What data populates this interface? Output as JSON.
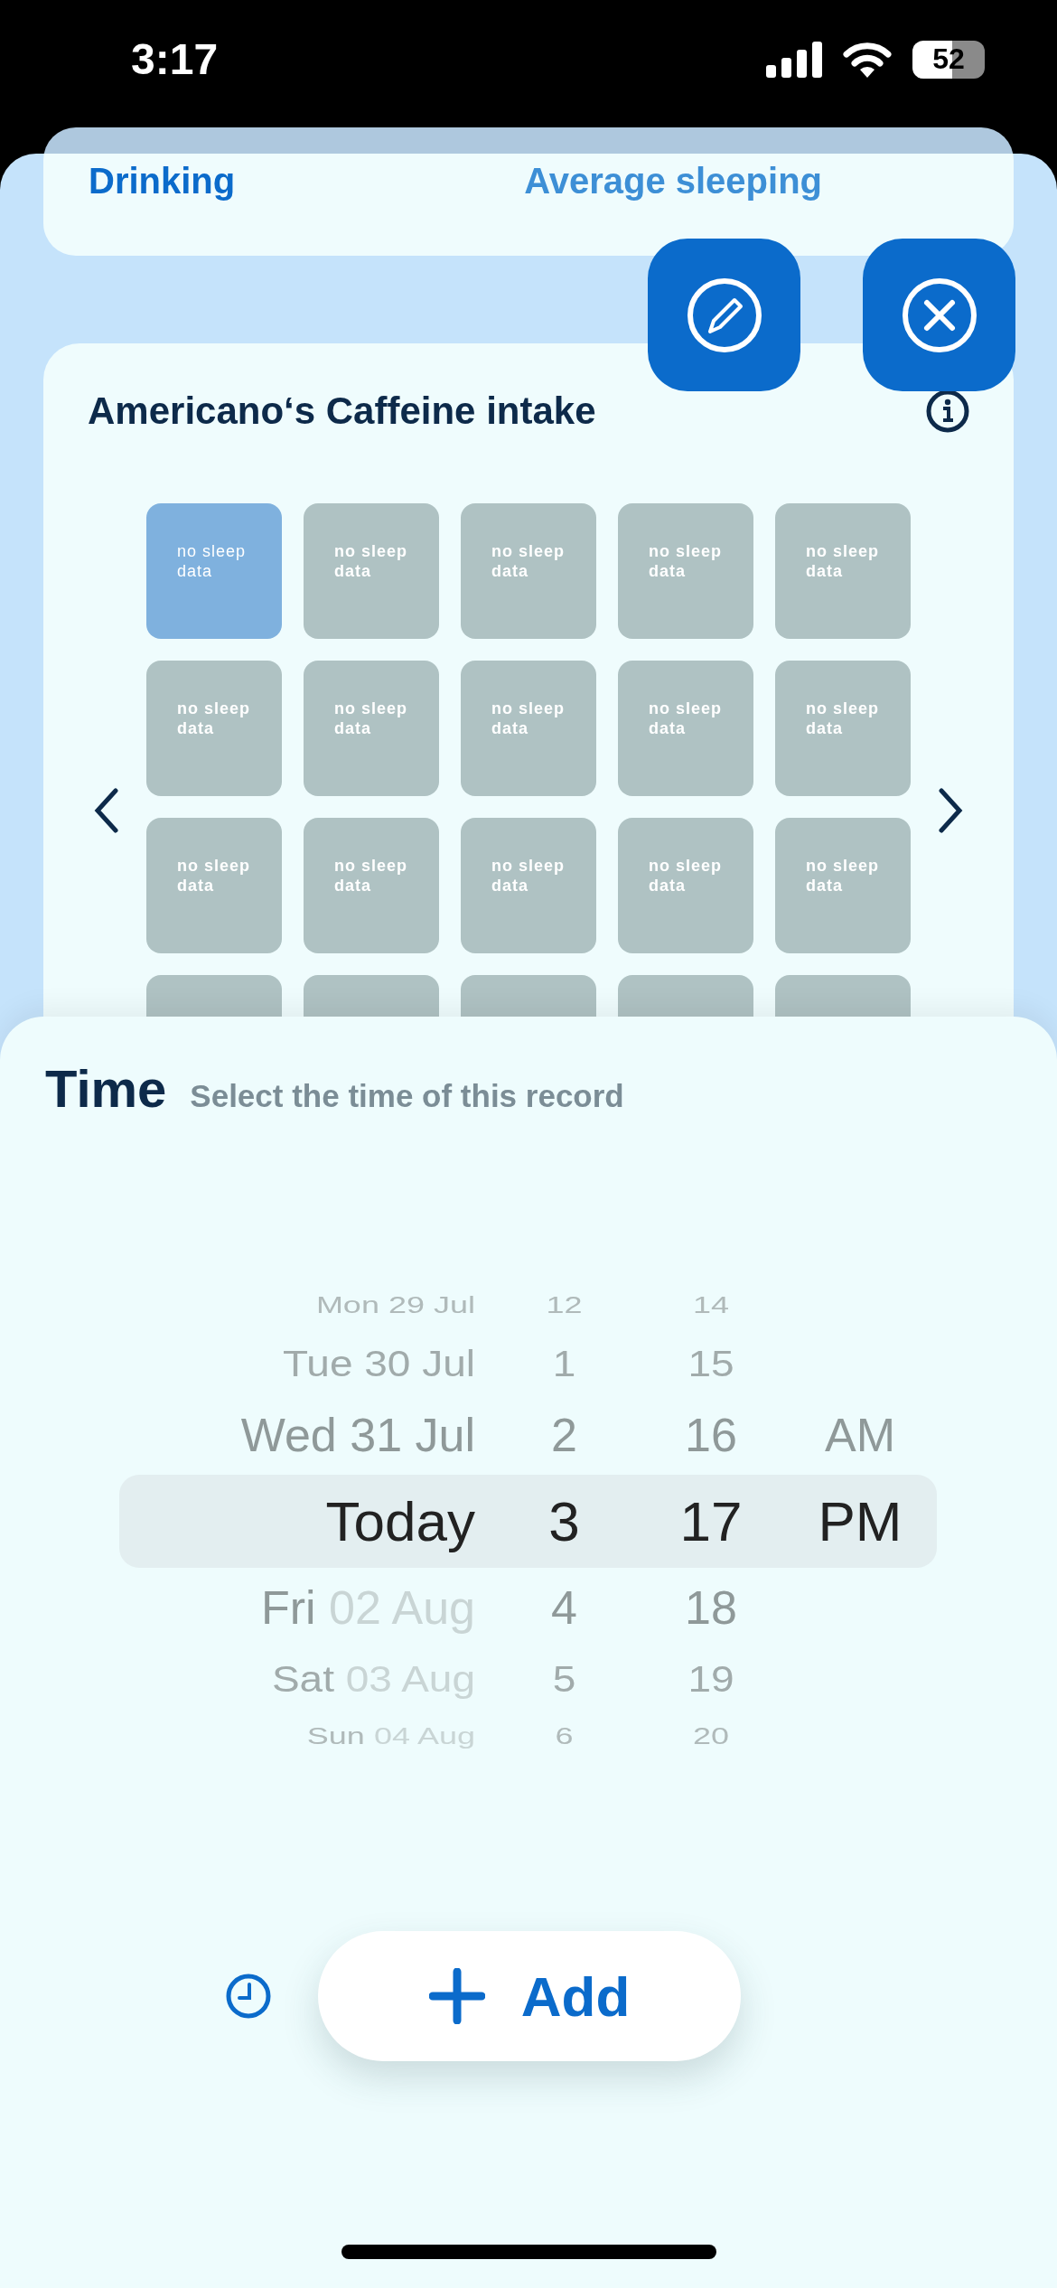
{
  "status_bar": {
    "time": "3:17",
    "battery": "52"
  },
  "summary_card": {
    "tabs": [
      {
        "label": "Drinking",
        "selected": true
      },
      {
        "label": "Average sleeping",
        "selected": false
      }
    ]
  },
  "intake_card": {
    "title": "Americano‘s Caffeine intake",
    "cells": [
      {
        "label": "no sleep data",
        "selected": true
      },
      {
        "label": "no sleep data",
        "selected": false
      },
      {
        "label": "no sleep data",
        "selected": false
      },
      {
        "label": "no sleep data",
        "selected": false
      },
      {
        "label": "no sleep data",
        "selected": false
      },
      {
        "label": "no sleep data",
        "selected": false
      },
      {
        "label": "no sleep data",
        "selected": false
      },
      {
        "label": "no sleep data",
        "selected": false
      },
      {
        "label": "no sleep data",
        "selected": false
      },
      {
        "label": "no sleep data",
        "selected": false
      },
      {
        "label": "no sleep data",
        "selected": false
      },
      {
        "label": "no sleep data",
        "selected": false
      },
      {
        "label": "no sleep data",
        "selected": false
      },
      {
        "label": "no sleep data",
        "selected": false
      },
      {
        "label": "no sleep data",
        "selected": false
      },
      {
        "selected": false
      },
      {
        "selected": false
      },
      {
        "selected": false
      },
      {
        "selected": false
      },
      {
        "selected": false
      }
    ]
  },
  "time_sheet": {
    "title": "Time",
    "subtitle": "Select the time of this record",
    "days": [
      {
        "weekday": "Mon",
        "date": "29 Jul",
        "future": false,
        "selected": false
      },
      {
        "weekday": "Tue",
        "date": "30 Jul",
        "future": false,
        "selected": false
      },
      {
        "weekday": "Wed",
        "date": "31 Jul",
        "future": false,
        "selected": false
      },
      {
        "weekday": "Today",
        "selected": true
      },
      {
        "weekday": "Fri",
        "date": "02 Aug",
        "future": true,
        "selected": false
      },
      {
        "weekday": "Sat",
        "date": "03 Aug",
        "future": true,
        "selected": false
      },
      {
        "weekday": "Sun",
        "date": "04 Aug",
        "future": true,
        "selected": false
      }
    ],
    "hours": [
      {
        "label": "12",
        "selected": false
      },
      {
        "label": "1",
        "selected": false
      },
      {
        "label": "2",
        "selected": false
      },
      {
        "label": "3",
        "selected": true
      },
      {
        "label": "4",
        "selected": false
      },
      {
        "label": "5",
        "selected": false
      },
      {
        "label": "6",
        "selected": false
      }
    ],
    "minutes": [
      {
        "label": "14",
        "selected": false
      },
      {
        "label": "15",
        "selected": false
      },
      {
        "label": "16",
        "selected": false
      },
      {
        "label": "17",
        "selected": true
      },
      {
        "label": "18",
        "selected": false
      },
      {
        "label": "19",
        "selected": false
      },
      {
        "label": "20",
        "selected": false
      }
    ],
    "periods": [
      {
        "label": "AM",
        "selected": false
      },
      {
        "label": "PM",
        "selected": true
      }
    ],
    "add_button": {
      "label": "Add"
    }
  }
}
